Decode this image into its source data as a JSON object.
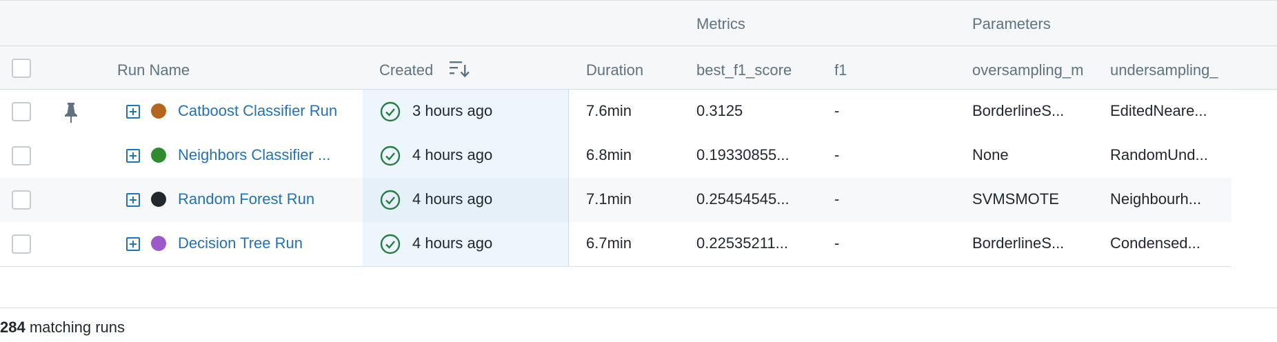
{
  "header": {
    "groups": {
      "metrics": "Metrics",
      "parameters": "Parameters"
    },
    "columns": {
      "run_name": "Run Name",
      "created": "Created",
      "duration": "Duration",
      "best_f1_score": "best_f1_score",
      "f1": "f1",
      "oversampling": "oversampling_m",
      "undersampling": "undersampling_"
    }
  },
  "rows": [
    {
      "name": "Catboost Classifier Run",
      "color": "#b5651d",
      "pinned": true,
      "created": "3 hours ago",
      "duration": "7.6min",
      "best_f1_score": "0.3125",
      "f1": "-",
      "oversampling": "BorderlineS...",
      "undersampling": "EditedNeare..."
    },
    {
      "name": "Neighbors Classifier ...",
      "color": "#2e8b2e",
      "pinned": false,
      "created": "4 hours ago",
      "duration": "6.8min",
      "best_f1_score": "0.19330855...",
      "f1": "-",
      "oversampling": "None",
      "undersampling": "RandomUnd..."
    },
    {
      "name": "Random Forest Run",
      "color": "#22282d",
      "pinned": false,
      "created": "4 hours ago",
      "duration": "7.1min",
      "best_f1_score": "0.25454545...",
      "f1": "-",
      "oversampling": "SVMSMOTE",
      "undersampling": "Neighbourh..."
    },
    {
      "name": "Decision Tree Run",
      "color": "#9b59c9",
      "pinned": false,
      "created": "4 hours ago",
      "duration": "6.7min",
      "best_f1_score": "0.22535211...",
      "f1": "-",
      "oversampling": "BorderlineS...",
      "undersampling": "Condensed..."
    }
  ],
  "footer": {
    "count": "284",
    "text": " matching runs"
  },
  "colors": {
    "link": "#2272b4",
    "success": "#277c43"
  }
}
